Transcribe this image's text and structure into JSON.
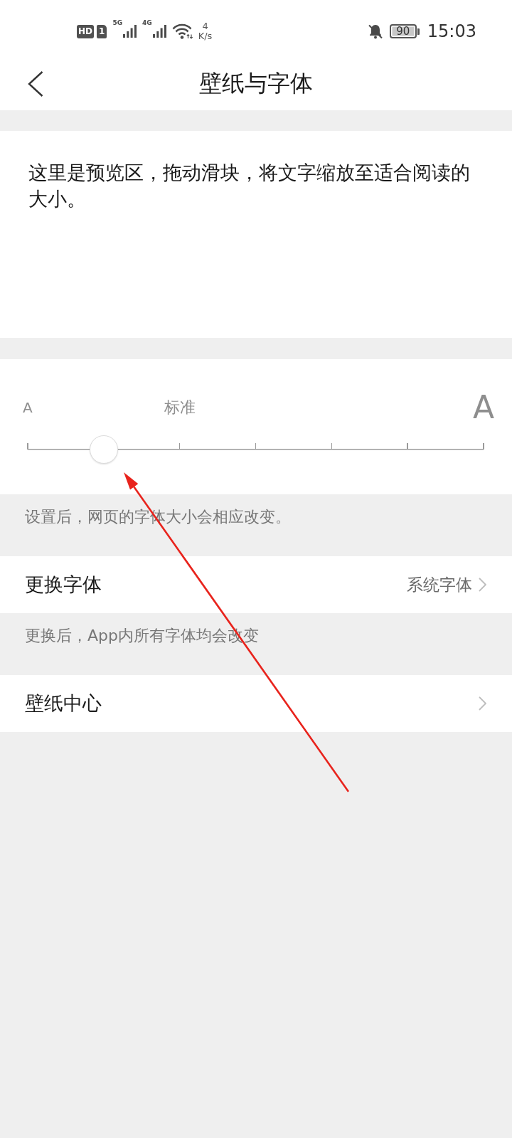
{
  "status_bar": {
    "hd_badge": "HD",
    "sim_badge": "1",
    "networks": [
      "5G",
      "4G"
    ],
    "speed_value": "4",
    "speed_unit": "K/s",
    "battery": "90",
    "time": "15:03"
  },
  "header": {
    "title": "壁纸与字体"
  },
  "preview": {
    "text": "这里是预览区，拖动滑块，将文字缩放至适合阅读的大小。"
  },
  "font_size": {
    "small_label": "A",
    "current_label": "标准",
    "large_label": "A",
    "level": 0.1667,
    "note": "设置后，网页的字体大小会相应改变。"
  },
  "settings": [
    {
      "label": "更换字体",
      "value": "系统字体",
      "note": "更换后，App内所有字体均会改变"
    },
    {
      "label": "壁纸中心"
    }
  ]
}
